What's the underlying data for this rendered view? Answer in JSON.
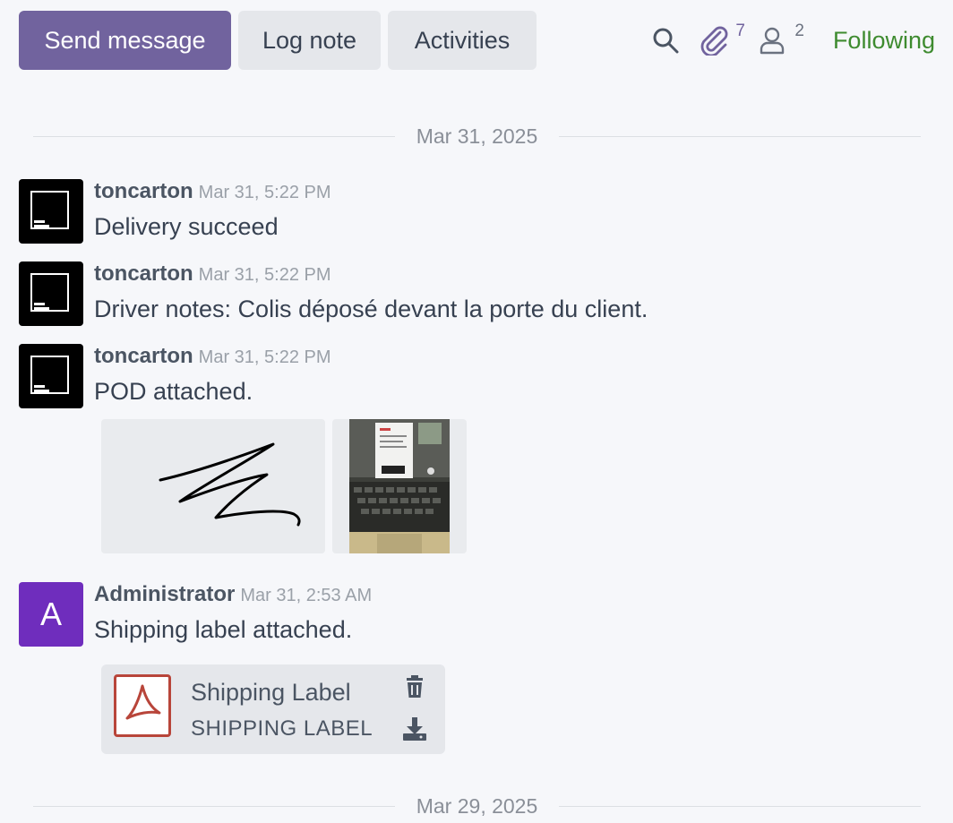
{
  "toolbar": {
    "send_message": "Send message",
    "log_note": "Log note",
    "activities": "Activities",
    "attachments_count": "7",
    "followers_count": "2",
    "following": "Following"
  },
  "separators": [
    {
      "date": "Mar 31, 2025"
    },
    {
      "date": "Mar 29, 2025"
    }
  ],
  "messages": [
    {
      "author": "toncarton",
      "time": "Mar 31, 5:22 PM",
      "text": "Delivery succeed",
      "avatar": "logo"
    },
    {
      "author": "toncarton",
      "time": "Mar 31, 5:22 PM",
      "text": "Driver notes: Colis déposé devant la porte du client.",
      "avatar": "logo"
    },
    {
      "author": "toncarton",
      "time": "Mar 31, 5:22 PM",
      "text": "POD attached.",
      "avatar": "logo"
    },
    {
      "author": "Administrator",
      "time": "Mar 31, 2:53 AM",
      "text": "Shipping label attached.",
      "avatar": "A"
    }
  ],
  "file": {
    "name": "Shipping Label",
    "type": "SHIPPING LABEL",
    "icon": "pdf-icon"
  },
  "colors": {
    "primary": "#71639e",
    "following": "#3e8b2f",
    "avatar_admin": "#6f2dbd",
    "pdf_red": "#b8453a"
  }
}
